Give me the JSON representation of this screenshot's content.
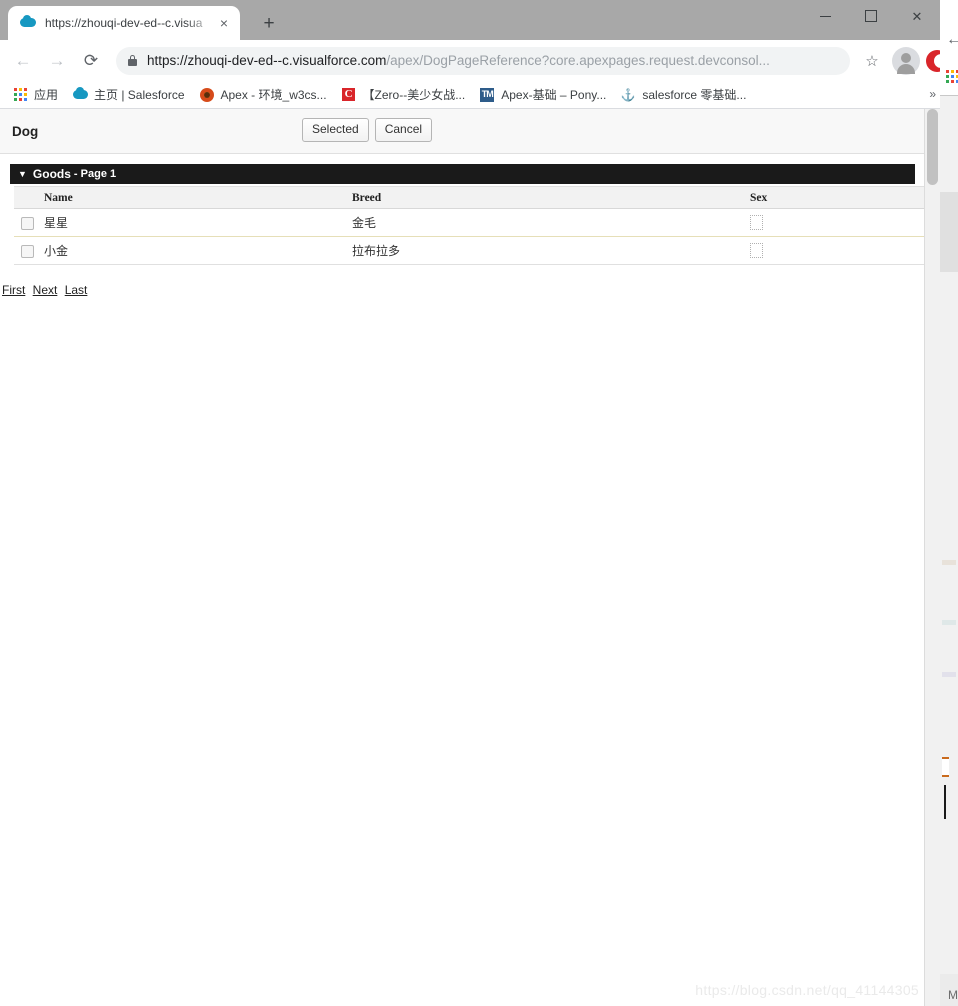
{
  "browser": {
    "tab": {
      "title": "https://zhouqi-dev-ed--c.visua",
      "favicon": "cloud-icon",
      "close_label": "×"
    },
    "newtab_label": "+",
    "window_controls": {
      "minimize": "minimize-icon",
      "maximize": "maximize-icon",
      "close": "close-icon"
    },
    "nav": {
      "back": "←",
      "forward": "→",
      "reload": "⟳"
    },
    "omnibox": {
      "lock": "lock-icon",
      "url_host": "https://zhouqi-dev-ed--c.visualforce.com",
      "url_path": "/apex/DogPageReference?core.apexpages.request.devconsol...",
      "star": "☆"
    },
    "bookmarks": [
      {
        "icon": "apps-grid-icon",
        "label": "应用"
      },
      {
        "icon": "cloud-icon",
        "label": "主页 | Salesforce"
      },
      {
        "icon": "flower-icon",
        "label": "Apex - 环境_w3cs..."
      },
      {
        "icon": "c-logo-icon",
        "label": "【Zero--美少女战..."
      },
      {
        "icon": "blue-tile-icon",
        "label": "Apex-基础 – Pony..."
      },
      {
        "icon": "anchor-icon",
        "label": "salesforce 零基础..."
      }
    ],
    "bookmarks_overflow": "»"
  },
  "page": {
    "title": "Dog",
    "buttons": [
      {
        "name": "selected-button",
        "label": "Selected"
      },
      {
        "name": "cancel-button",
        "label": "Cancel"
      }
    ],
    "section": {
      "toggle": "▼",
      "name": "Goods",
      "sub": "- Page 1"
    },
    "table": {
      "columns": [
        "",
        "Name",
        "Breed",
        "Sex"
      ],
      "rows": [
        {
          "checked": false,
          "name": "星星",
          "breed": "金毛",
          "sex": "broken-image-icon"
        },
        {
          "checked": false,
          "name": "小金",
          "breed": "拉布拉多",
          "sex": "broken-image-icon"
        }
      ]
    },
    "pager": [
      {
        "name": "first-link",
        "label": "First"
      },
      {
        "name": "next-link",
        "label": "Next"
      },
      {
        "name": "last-link",
        "label": "Last"
      }
    ]
  },
  "watermark": "https://blog.csdn.net/qq_41144305",
  "background_window": {
    "back": "←",
    "apps": "apps-grid-icon",
    "corner_letter": "M"
  },
  "colors": {
    "tabstrip": "#a8a8a8",
    "section_bar": "#1a1a1a",
    "row_divider": "#e6dfb8",
    "omnibox": "#f1f3f4",
    "accent_red": "#d9252a",
    "cloud_blue": "#1798c1"
  }
}
